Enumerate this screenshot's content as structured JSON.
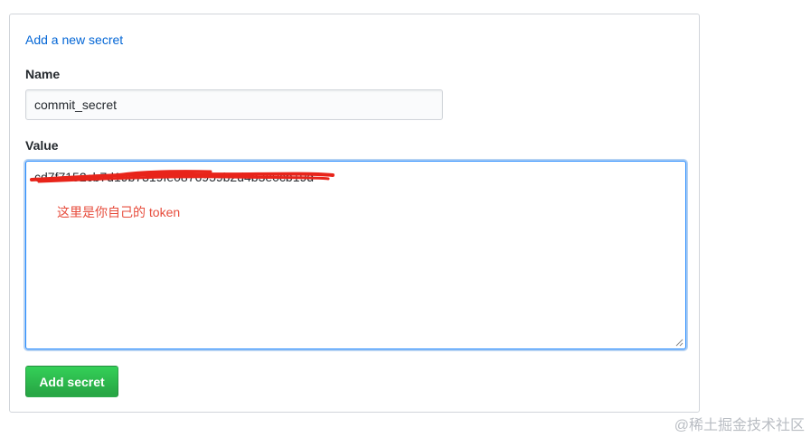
{
  "panel": {
    "link_label": "Add a new secret"
  },
  "form": {
    "name_label": "Name",
    "name_value": "commit_secret",
    "value_label": "Value",
    "value_text": "cd7f7152cb7d19b7319fe0876959b2d4b3e0cb19d",
    "annotation": "这里是你自己的 token",
    "submit_label": "Add secret"
  },
  "watermark": "@稀土掘金技术社区",
  "colors": {
    "link": "#0366d6",
    "button_green": "#28a745",
    "focus_border": "#2188ff",
    "annotation_red": "#e74c3c",
    "redaction_red": "#e8241a"
  }
}
